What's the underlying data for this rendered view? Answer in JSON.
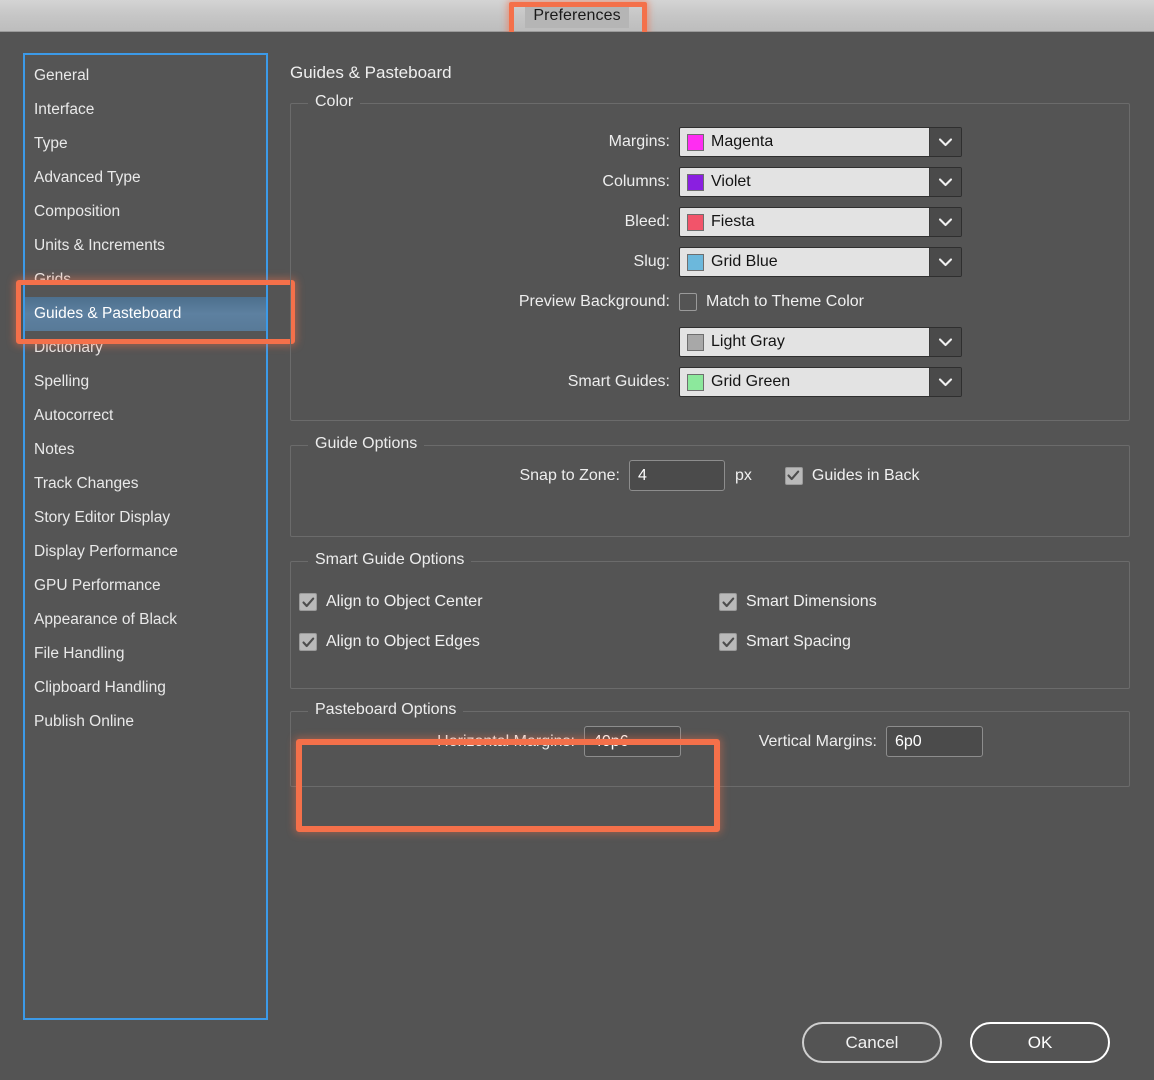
{
  "window": {
    "title": "Preferences"
  },
  "sidebar": {
    "items": [
      {
        "label": "General",
        "selected": false
      },
      {
        "label": "Interface",
        "selected": false
      },
      {
        "label": "Type",
        "selected": false
      },
      {
        "label": "Advanced Type",
        "selected": false
      },
      {
        "label": "Composition",
        "selected": false
      },
      {
        "label": "Units & Increments",
        "selected": false
      },
      {
        "label": "Grids",
        "selected": false
      },
      {
        "label": "Guides & Pasteboard",
        "selected": true
      },
      {
        "label": "Dictionary",
        "selected": false
      },
      {
        "label": "Spelling",
        "selected": false
      },
      {
        "label": "Autocorrect",
        "selected": false
      },
      {
        "label": "Notes",
        "selected": false
      },
      {
        "label": "Track Changes",
        "selected": false
      },
      {
        "label": "Story Editor Display",
        "selected": false
      },
      {
        "label": "Display Performance",
        "selected": false
      },
      {
        "label": "GPU Performance",
        "selected": false
      },
      {
        "label": "Appearance of Black",
        "selected": false
      },
      {
        "label": "File Handling",
        "selected": false
      },
      {
        "label": "Clipboard Handling",
        "selected": false
      },
      {
        "label": "Publish Online",
        "selected": false
      }
    ]
  },
  "main": {
    "title": "Guides & Pasteboard",
    "color_section": {
      "legend": "Color",
      "rows": {
        "margins": {
          "label": "Margins:",
          "value": "Magenta",
          "swatch": "#ff2df2"
        },
        "columns": {
          "label": "Columns:",
          "value": "Violet",
          "swatch": "#8a1fe0"
        },
        "bleed": {
          "label": "Bleed:",
          "value": "Fiesta",
          "swatch": "#f2546a"
        },
        "slug": {
          "label": "Slug:",
          "value": "Grid Blue",
          "swatch": "#6cb8dc"
        },
        "preview_background": {
          "label": "Preview Background:",
          "checkbox_label": "Match to Theme Color",
          "checked": false,
          "value": "Light Gray",
          "swatch": "#a8a8a8"
        },
        "smart_guides": {
          "label": "Smart Guides:",
          "value": "Grid Green",
          "swatch": "#8ce89c"
        }
      }
    },
    "guide_options": {
      "legend": "Guide Options",
      "snap_label": "Snap to Zone:",
      "snap_value": "4",
      "snap_unit": "px",
      "guides_in_back_label": "Guides in Back",
      "guides_in_back_checked": true
    },
    "smart_guide_options": {
      "legend": "Smart Guide Options",
      "items": [
        {
          "label": "Align to Object Center",
          "checked": true
        },
        {
          "label": "Smart Dimensions",
          "checked": true
        },
        {
          "label": "Align to Object Edges",
          "checked": true
        },
        {
          "label": "Smart Spacing",
          "checked": true
        }
      ]
    },
    "pasteboard_options": {
      "legend": "Pasteboard Options",
      "horizontal_label": "Horizontal Margins:",
      "horizontal_value": "40p6",
      "vertical_label": "Vertical Margins:",
      "vertical_value": "6p0"
    }
  },
  "footer": {
    "cancel_label": "Cancel",
    "ok_label": "OK"
  },
  "annotations": {
    "highlight_color": "#f4704a"
  }
}
